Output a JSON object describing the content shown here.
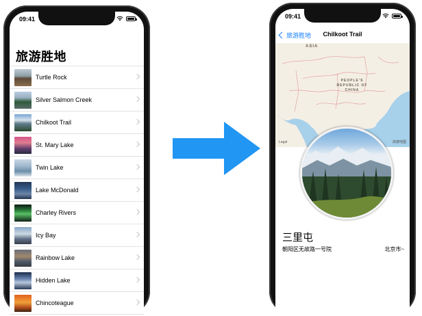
{
  "list_screen": {
    "status_time": "09:41",
    "large_title": "旅游胜地",
    "items": [
      {
        "label": "Turtle Rock"
      },
      {
        "label": "Silver Salmon Creek"
      },
      {
        "label": "Chilkoot Trail"
      },
      {
        "label": "St. Mary Lake"
      },
      {
        "label": "Twin Lake"
      },
      {
        "label": "Lake McDonald"
      },
      {
        "label": "Charley Rivers"
      },
      {
        "label": "Icy Bay"
      },
      {
        "label": "Rainbow Lake"
      },
      {
        "label": "Hidden Lake"
      },
      {
        "label": "Chincoteague"
      }
    ]
  },
  "arrow": {
    "color": "#2196f3"
  },
  "detail_screen": {
    "status_time": "09:41",
    "back_label": "旅游胜地",
    "nav_title": "Chilkoot Trail",
    "map": {
      "label_asia": "ASIA",
      "label_china": "PEOPLE'S REPUBLIC OF CHINA",
      "legal": "Legal",
      "attribution": "高德地图"
    },
    "name": "三里屯",
    "address": "朝阳区无故路一号院",
    "city": "北京市~"
  },
  "colors": {
    "ios_blue": "#147efb",
    "map_water": "#a7d0ea",
    "map_land": "#f4efe4"
  }
}
